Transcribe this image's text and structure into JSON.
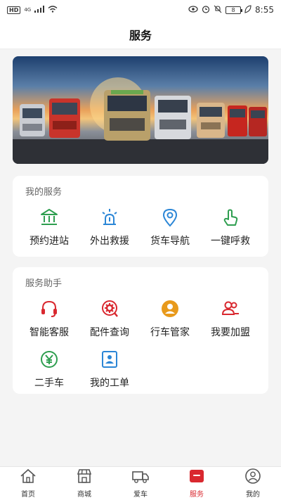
{
  "status_bar": {
    "hd": "HD",
    "network": "4G",
    "battery": "8",
    "time": "8:55"
  },
  "header": {
    "title": "服务"
  },
  "services": {
    "title": "我的服务",
    "items": [
      {
        "label": "预约进站",
        "icon": "station-icon",
        "color": "#2e9e4f"
      },
      {
        "label": "外出救援",
        "icon": "rescue-beacon-icon",
        "color": "#2b86d6"
      },
      {
        "label": "货车导航",
        "icon": "location-pin-icon",
        "color": "#2b86d6"
      },
      {
        "label": "一键呼救",
        "icon": "touch-hand-icon",
        "color": "#2e9e4f"
      }
    ]
  },
  "assistant": {
    "title": "服务助手",
    "items": [
      {
        "label": "智能客服",
        "icon": "headset-icon",
        "color": "#d9282f"
      },
      {
        "label": "配件查询",
        "icon": "gear-search-icon",
        "color": "#d9282f"
      },
      {
        "label": "行车管家",
        "icon": "driver-avatar-icon",
        "color": "#e89a1c"
      },
      {
        "label": "我要加盟",
        "icon": "add-user-icon",
        "color": "#d9282f"
      },
      {
        "label": "二手车",
        "icon": "yuan-icon",
        "color": "#2e9e4f"
      },
      {
        "label": "我的工单",
        "icon": "work-order-icon",
        "color": "#2b86d6"
      }
    ]
  },
  "tabbar": {
    "active_color": "#d9282f",
    "tabs": [
      {
        "label": "首页",
        "icon": "home-icon"
      },
      {
        "label": "商城",
        "icon": "store-icon"
      },
      {
        "label": "爱车",
        "icon": "truck-icon"
      },
      {
        "label": "服务",
        "icon": "service-icon"
      },
      {
        "label": "我的",
        "icon": "profile-icon"
      }
    ]
  }
}
